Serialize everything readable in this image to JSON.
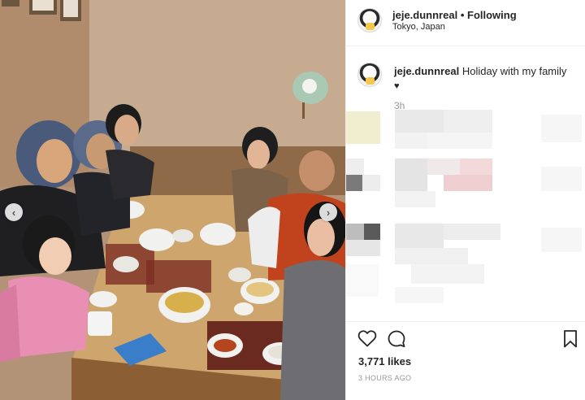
{
  "post": {
    "username": "jeje.dunnreal",
    "separator": "•",
    "follow_status": "Following",
    "location": "Tokyo, Japan"
  },
  "caption": {
    "username": "jeje.dunnreal",
    "text": "Holiday with my family",
    "emoji": "♥",
    "time_ago": "3h"
  },
  "actions": {
    "likes": "3,771 likes",
    "posted": "3 HOURS AGO"
  },
  "icons": {
    "prev": "chevron-left-icon",
    "next": "chevron-right-icon",
    "like": "heart-icon",
    "comment": "comment-icon",
    "save": "bookmark-icon"
  },
  "colors": {
    "text": "#262626",
    "muted": "#999999",
    "border": "#efefef"
  }
}
